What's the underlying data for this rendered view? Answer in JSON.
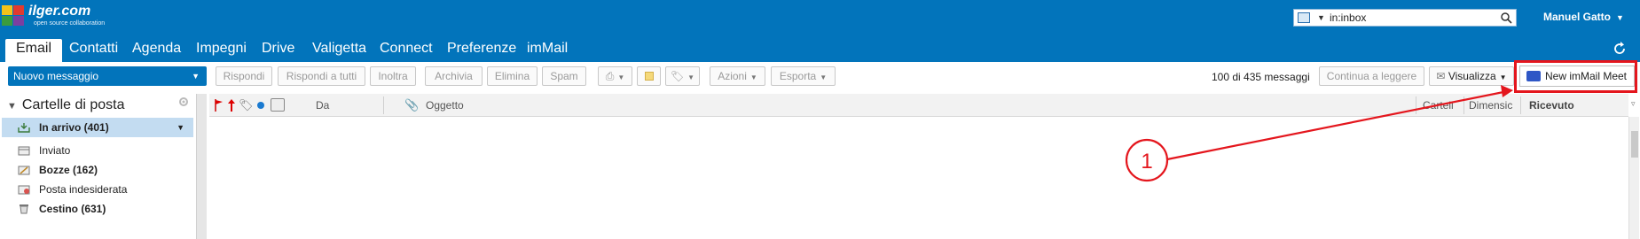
{
  "logo": {
    "brand": "ilger.com",
    "tagline": "open source collaboration"
  },
  "search": {
    "value": "in:inbox"
  },
  "user": {
    "name": "Manuel Gatto"
  },
  "tabs": [
    "Email",
    "Contatti",
    "Agenda",
    "Impegni",
    "Drive",
    "Valigetta",
    "Connect",
    "Preferenze",
    "imMail"
  ],
  "toolbar": {
    "new_message": "Nuovo messaggio",
    "reply": "Rispondi",
    "reply_all": "Rispondi a tutti",
    "forward": "Inoltra",
    "archive": "Archivia",
    "delete": "Elimina",
    "spam": "Spam",
    "actions": "Azioni",
    "export": "Esporta",
    "count": "100 di 435 messaggi",
    "continue_reading": "Continua a leggere",
    "view": "Visualizza",
    "new_meet": "New imMail Meet"
  },
  "sidebar": {
    "header": "Cartelle di posta",
    "folders": [
      {
        "label": "In arrivo (401)",
        "icon": "inbox-icon"
      },
      {
        "label": "Inviato",
        "icon": "sent-icon"
      },
      {
        "label": "Bozze (162)",
        "icon": "drafts-icon"
      },
      {
        "label": "Posta indesiderata",
        "icon": "junk-icon"
      },
      {
        "label": "Cestino (631)",
        "icon": "trash-icon"
      }
    ]
  },
  "list": {
    "columns": {
      "from": "Da",
      "subject": "Oggetto",
      "folder": "Cartell",
      "size": "Dimensic",
      "received": "Ricevuto"
    }
  },
  "annotation": {
    "label": "1"
  },
  "colors": {
    "brand_blue": "#0274bb",
    "highlight_red": "#e4161d"
  }
}
